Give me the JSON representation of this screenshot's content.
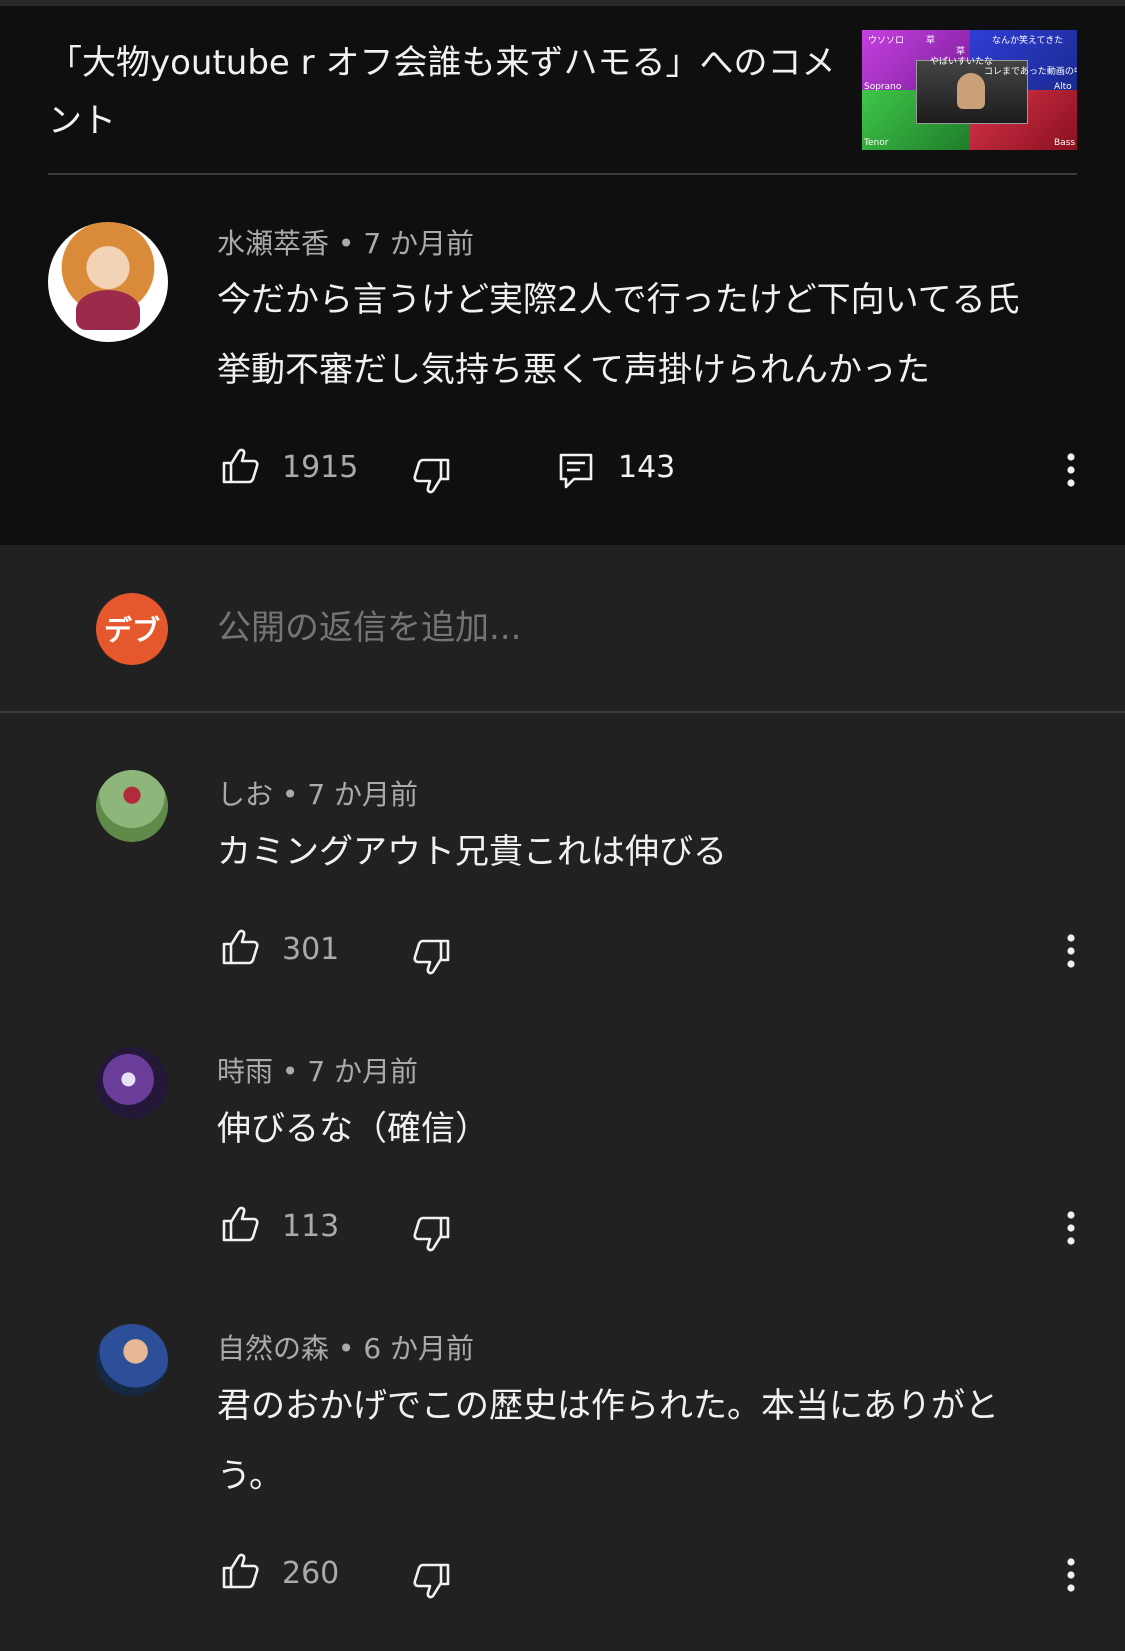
{
  "header": {
    "title": "「大物youtube r オフ会誰も来ずハモる」へのコメント",
    "thumbnail_texts": [
      "ウソソロ",
      "草",
      "草",
      "なんか笑えてきた",
      "やばいすいたな",
      "コレまであった動画の中",
      "Soprano",
      "Alto",
      "Tenor",
      "Bass"
    ]
  },
  "main_comment": {
    "author": "水瀬萃香",
    "separator": "•",
    "time": "7 か月前",
    "text_line1": "今だから言うけど実際2人で行ったけど下向いてる氏",
    "text_line2": "挙動不審だし気持ち悪くて声掛けられんかった",
    "likes": "1915",
    "replies": "143",
    "icons": {
      "like": "thumbs-up-icon",
      "dislike": "thumbs-down-icon",
      "reply": "comment-icon",
      "more": "more-vert-icon"
    }
  },
  "reply_box": {
    "avatar_text": "デブ",
    "avatar_color": "#e5572c",
    "placeholder": "公開の返信を追加..."
  },
  "replies": [
    {
      "author": "しお",
      "separator": "•",
      "time": "7 か月前",
      "text_line1": "カミングアウト兄貴これは伸びる",
      "text_line2": "",
      "likes": "301"
    },
    {
      "author": "時雨",
      "separator": "•",
      "time": "7 か月前",
      "text_line1": "伸びるな（確信）",
      "text_line2": "",
      "likes": "113"
    },
    {
      "author": "自然の森",
      "separator": "•",
      "time": "6 か月前",
      "text_line1": "君のおかげでこの歴史は作られた。本当にありがと",
      "text_line2": "う。",
      "likes": "260"
    }
  ],
  "colors": {
    "header_bg": "#0f0f0f",
    "page_bg": "#212121",
    "primary_text": "#f1f1f1",
    "secondary_text": "#aaaaaa"
  }
}
